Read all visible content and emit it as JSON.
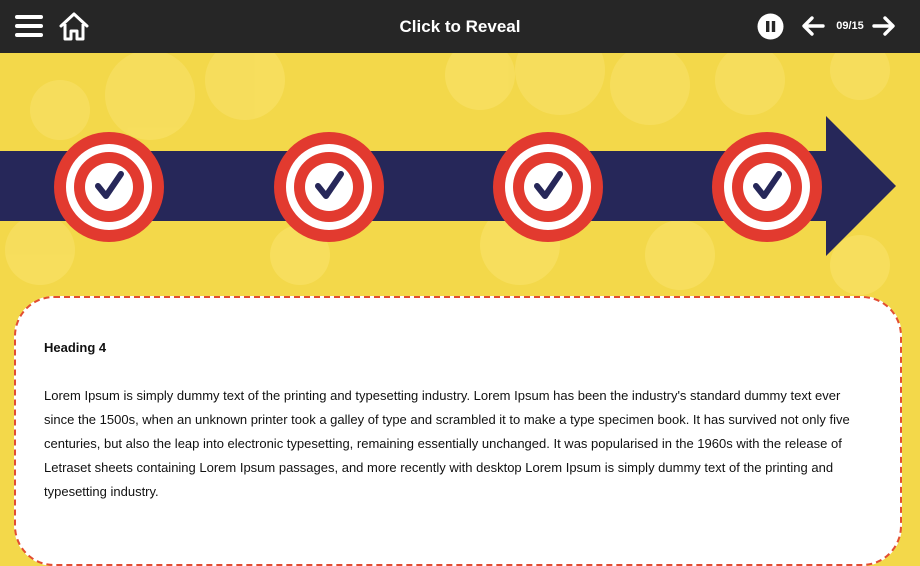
{
  "header": {
    "title": "Click to Reveal",
    "page_indicator": "09/15",
    "icons": [
      "menu-icon",
      "home-icon",
      "pause-icon",
      "arrow-left-icon",
      "arrow-right-icon"
    ]
  },
  "timeline": {
    "markers": [
      {
        "icon": "check-icon",
        "state": "completed"
      },
      {
        "icon": "check-icon",
        "state": "completed"
      },
      {
        "icon": "check-icon",
        "state": "completed"
      },
      {
        "icon": "check-icon",
        "state": "completed"
      }
    ]
  },
  "content": {
    "heading": "Heading 4",
    "body": "Lorem Ipsum is simply dummy text of the printing and typesetting industry. Lorem Ipsum has been the industry's standard dummy text ever since the 1500s, when an unknown printer took a galley of type and scrambled it to make a type specimen book. It has survived not only five centuries, but also the leap into electronic typesetting, remaining essentially unchanged. It was popularised in the 1960s with the release of Letraset sheets containing Lorem Ipsum passages, and more recently with desktop Lorem Ipsum is simply dummy text of the printing and typesetting industry."
  },
  "colors": {
    "header_bg": "#262626",
    "background": "#f3d84a",
    "arrow": "#262759",
    "target_red": "#e23a2f",
    "card_border": "#e24d32"
  }
}
